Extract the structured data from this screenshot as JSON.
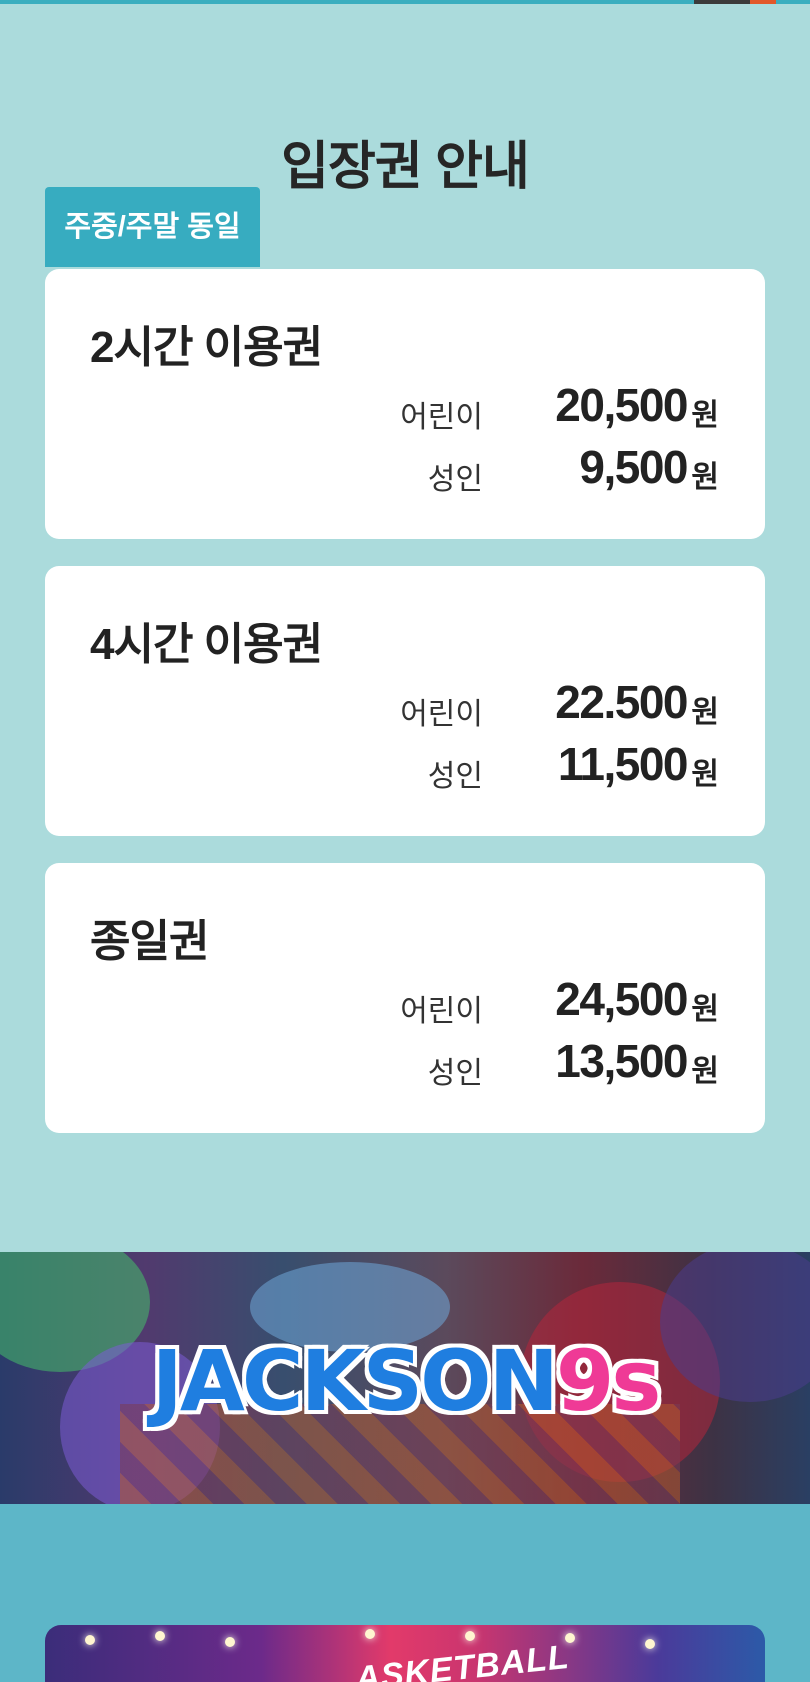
{
  "page": {
    "title": "입장권 안내",
    "badge": "주중/주말 동일"
  },
  "tickets": [
    {
      "name": "2시간 이용권",
      "prices": [
        {
          "label": "어린이",
          "amount": "20,500",
          "unit": "원"
        },
        {
          "label": "성인",
          "amount": "9,500",
          "unit": "원"
        }
      ]
    },
    {
      "name": "4시간 이용권",
      "prices": [
        {
          "label": "어린이",
          "amount": "22.500",
          "unit": "원"
        },
        {
          "label": "성인",
          "amount": "11,500",
          "unit": "원"
        }
      ]
    },
    {
      "name": "종일권",
      "prices": [
        {
          "label": "어린이",
          "amount": "24,500",
          "unit": "원"
        },
        {
          "label": "성인",
          "amount": "13,500",
          "unit": "원"
        }
      ]
    }
  ],
  "banner": {
    "logo_main": "JACKSON",
    "logo_accent": "9s"
  },
  "promo": {
    "sign_text": "ASKETBALL"
  },
  "colors": {
    "background": "#abdbdc",
    "badge": "#37acc0",
    "card": "#ffffff",
    "logo_blue": "#1f7ee0",
    "logo_pink": "#ef3a96",
    "lower_section": "#5db6c8"
  }
}
